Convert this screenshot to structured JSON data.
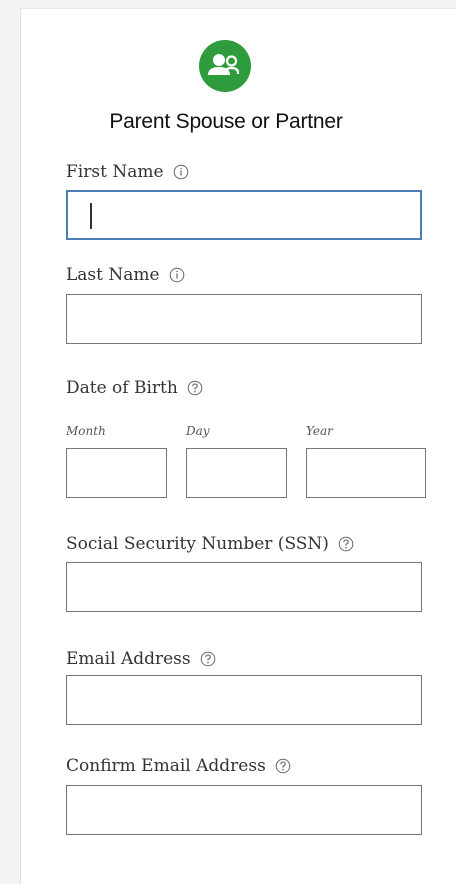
{
  "heading": "Parent Spouse or Partner",
  "header_icon": "parent-partner-icon",
  "accent_color": "#2e9c3c",
  "form": {
    "first_name": {
      "label": "First Name",
      "icon": "info-icon",
      "value": ""
    },
    "last_name": {
      "label": "Last Name",
      "icon": "info-icon",
      "value": ""
    },
    "date_of_birth": {
      "label": "Date of Birth",
      "icon": "help-icon",
      "month_label": "Month",
      "day_label": "Day",
      "year_label": "Year",
      "month_value": "",
      "day_value": "",
      "year_value": ""
    },
    "ssn": {
      "label": "Social Security Number (SSN)",
      "icon": "help-icon",
      "value": ""
    },
    "email": {
      "label": "Email Address",
      "icon": "help-icon",
      "value": ""
    },
    "confirm_email": {
      "label": "Confirm Email Address",
      "icon": "help-icon",
      "value": ""
    }
  }
}
